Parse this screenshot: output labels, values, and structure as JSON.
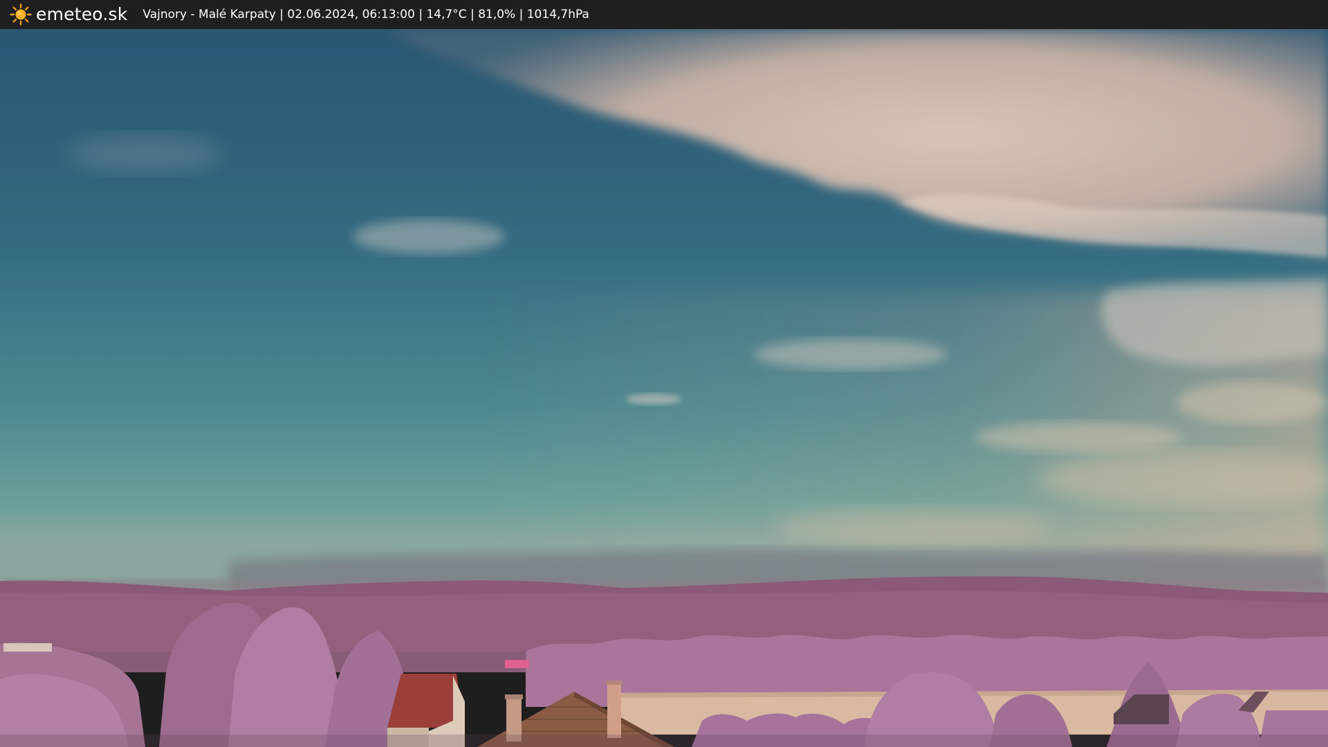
{
  "header": {
    "brand": "emeteo.sk",
    "logo_icon": "sun-icon",
    "caption": "Vajnory - Malé Karpaty | 02.06.2024, 06:13:00 | 14,7°C | 81,0% | 1014,7hPa"
  },
  "colors": {
    "bar_background": "#1f1f1f",
    "sun": "#f0a020",
    "sky_top": "#2b5873",
    "sky_horizon": "#5f9a94",
    "foliage": "#a8779b",
    "hills": "#83566f",
    "field": "#d8b8a0"
  }
}
